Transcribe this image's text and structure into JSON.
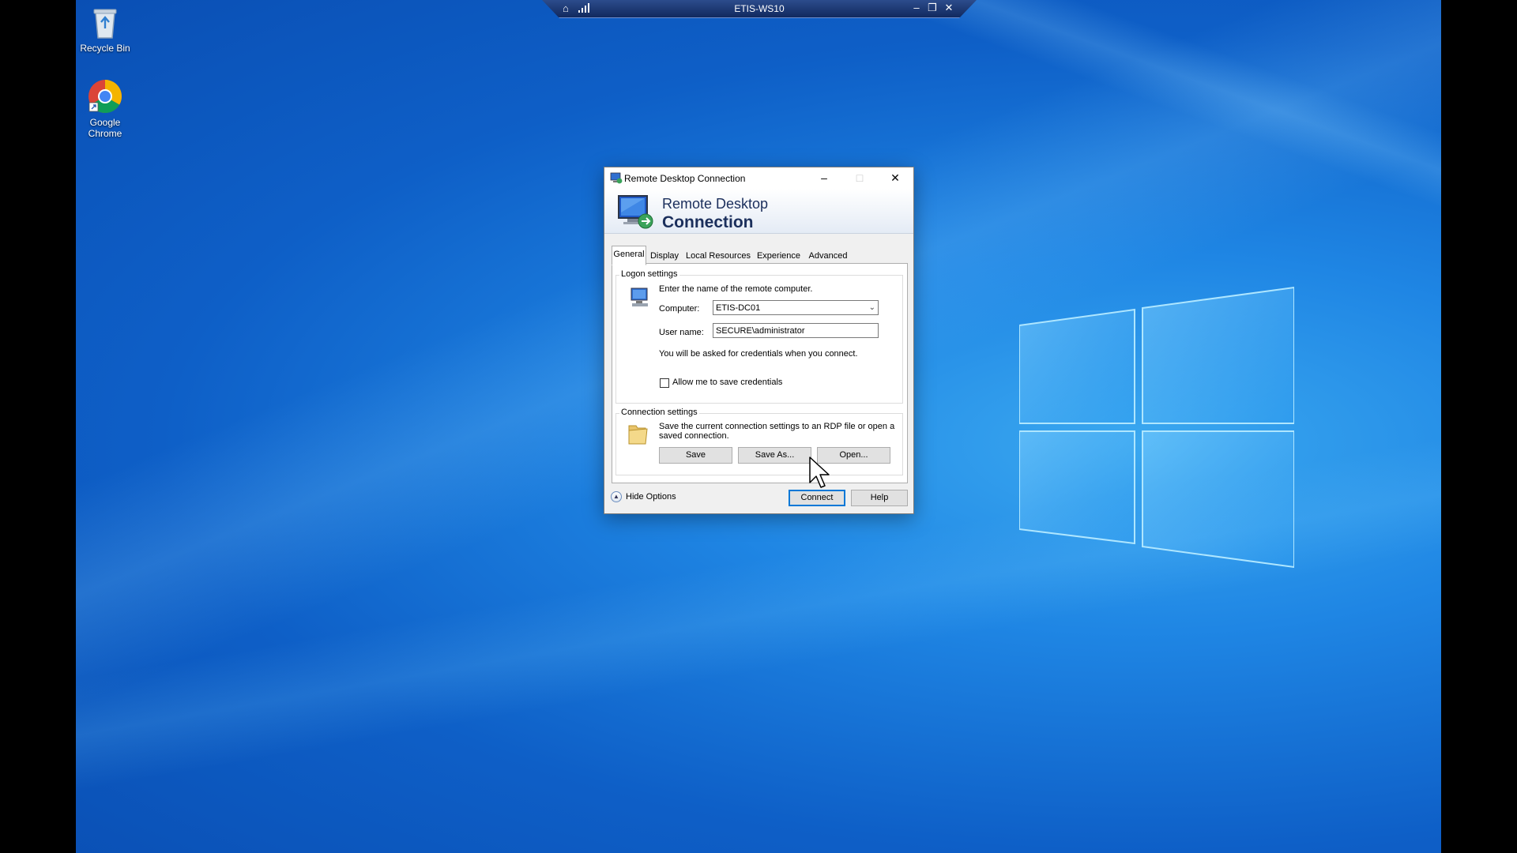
{
  "desktop": {
    "icons": [
      {
        "label": "Recycle Bin",
        "icon": "recycle-bin-icon"
      },
      {
        "label": "Google Chrome",
        "icon": "chrome-icon"
      }
    ]
  },
  "rdp_bar": {
    "title": "ETIS-WS10",
    "pin_glyph": "⌂",
    "minimize_glyph": "–",
    "restore_glyph": "❐",
    "close_glyph": "✕"
  },
  "dialog": {
    "title": "Remote Desktop Connection",
    "banner": {
      "line1": "Remote Desktop",
      "line2": "Connection"
    },
    "titlebar_buttons": {
      "minimize": "–",
      "maximize": "□",
      "close": "✕"
    },
    "tabs": [
      {
        "label": "General",
        "active": true
      },
      {
        "label": "Display"
      },
      {
        "label": "Local Resources"
      },
      {
        "label": "Experience"
      },
      {
        "label": "Advanced"
      }
    ],
    "logon": {
      "group_label": "Logon settings",
      "instruction": "Enter the name of the remote computer.",
      "computer_label": "Computer:",
      "computer_value": "ETIS-DC01",
      "username_label": "User name:",
      "username_value": "SECURE\\administrator",
      "credentials_note": "You will be asked for credentials when you connect.",
      "save_credentials_label": "Allow me to save credentials",
      "save_credentials_checked": false
    },
    "connection": {
      "group_label": "Connection settings",
      "description_line1": "Save the current connection settings to an RDP file or open a",
      "description_line2": "saved connection.",
      "save_button": "Save",
      "save_as_button": "Save As...",
      "open_button": "Open..."
    },
    "footer": {
      "hide_options": "Hide Options",
      "connect_button": "Connect",
      "help_button": "Help"
    }
  },
  "colors": {
    "desktop_blue": "#1f86e4",
    "rdp_bar": "#1d3a75",
    "default_button_border": "#0078d7",
    "banner_text": "#1b2f5c"
  }
}
